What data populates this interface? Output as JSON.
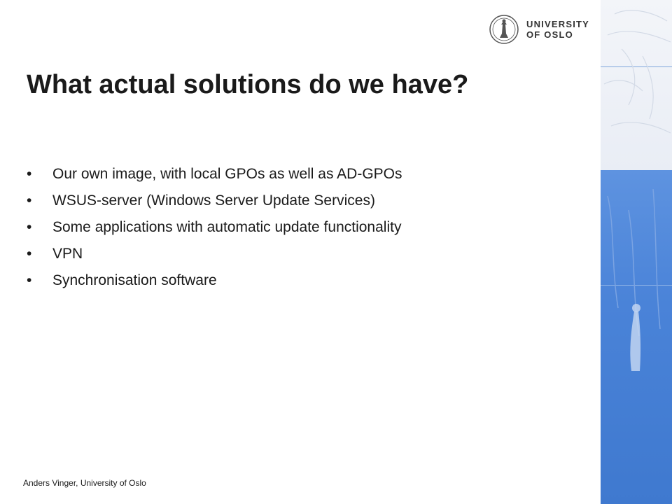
{
  "logo": {
    "icon": "university-seal-icon",
    "line1": "UNIVERSITY",
    "line2": "OF OSLO"
  },
  "title": "What actual solutions do we have?",
  "bullet_glyph": "•",
  "bullets": [
    "Our own image, with local GPOs as well as AD-GPOs",
    "WSUS-server (Windows Server Update Services)",
    "Some applications with automatic update functionality",
    "VPN",
    "Synchronisation software"
  ],
  "footer": "Anders Vinger, University of Oslo",
  "colors": {
    "panel_top": "#eef1f7",
    "panel_blue": "#4a83d8",
    "text": "#1a1a1a"
  }
}
